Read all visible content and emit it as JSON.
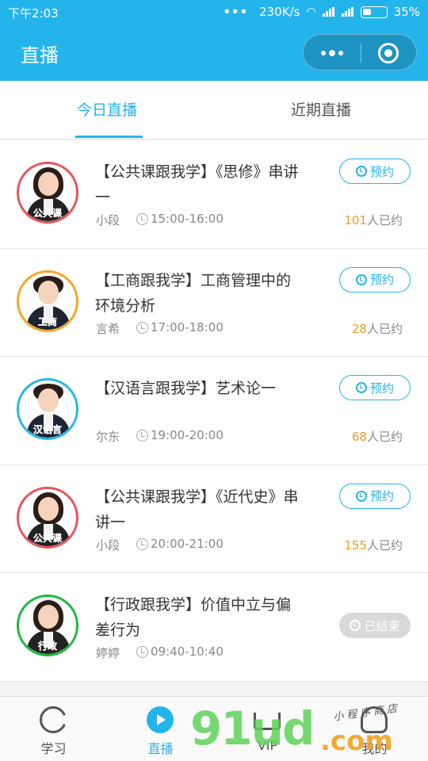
{
  "status_bar": {
    "time": "下午2:03",
    "dots": "•••",
    "speed": "230K/s",
    "battery": "35%"
  },
  "header": {
    "title": "直播"
  },
  "tabs": [
    {
      "label": "今日直播",
      "active": true
    },
    {
      "label": "近期直播",
      "active": false
    }
  ],
  "items": [
    {
      "title": "【公共课跟我学】《思修》串讲一",
      "teacher": "小段",
      "time": "15:00-16:00",
      "booked_count": "101",
      "booked_suffix": "人已约",
      "button": "预约",
      "tag": "公共课",
      "ring_color": "#e9545a"
    },
    {
      "title": "【工商跟我学】工商管理中的环境分析",
      "teacher": "言希",
      "time": "17:00-18:00",
      "booked_count": "28",
      "booked_suffix": "人已约",
      "button": "预约",
      "tag": "工商",
      "ring_color": "#f5a623"
    },
    {
      "title": "【汉语言跟我学】艺术论一",
      "teacher": "尔东",
      "time": "19:00-20:00",
      "booked_count": "68",
      "booked_suffix": "人已约",
      "button": "预约",
      "tag": "汉语言",
      "ring_color": "#28b8e8"
    },
    {
      "title": "【公共课跟我学】《近代史》串讲一",
      "teacher": "小段",
      "time": "20:00-21:00",
      "booked_count": "155",
      "booked_suffix": "人已约",
      "button": "预约",
      "tag": "公共课",
      "ring_color": "#e9545a"
    },
    {
      "title": "【行政跟我学】价值中立与偏差行为",
      "teacher": "婷婷",
      "time": "09:40-10:40",
      "booked_count": "",
      "booked_suffix": "",
      "button": "已结束",
      "tag": "行政",
      "ring_color": "#1cb93a"
    }
  ],
  "nav": [
    {
      "label": "学习",
      "icon": "pacman-icon"
    },
    {
      "label": "直播",
      "icon": "play-icon"
    },
    {
      "label": "VIP",
      "icon": "crown-icon"
    },
    {
      "label": "我的",
      "icon": "person-icon"
    }
  ],
  "watermark": {
    "main": "91ud",
    "sub": ".com",
    "small": "小程序商店"
  },
  "colors": {
    "accent": "#24b4ec",
    "count": "#f39a1e",
    "ended": "#d9d9d9"
  }
}
